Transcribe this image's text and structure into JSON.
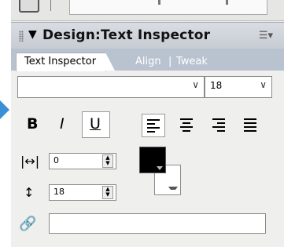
{
  "panel": {
    "title": "Design:Text Inspector",
    "collapse_glyph": "▼",
    "menu_icon": "panel-menu-icon"
  },
  "tabs": [
    {
      "label": "Text Inspector",
      "active": true
    },
    {
      "label": "Align",
      "active": false
    },
    {
      "label": "Tweak",
      "active": false
    }
  ],
  "tab_separator": "|",
  "font": {
    "family_value": "",
    "size_value": "18"
  },
  "style_buttons": {
    "bold": "B",
    "italic": "I",
    "underline": "U"
  },
  "alignment": {
    "selected": "left",
    "options": [
      "left",
      "center",
      "right",
      "justify"
    ]
  },
  "kerning": {
    "value": "0"
  },
  "leading": {
    "value": "18"
  },
  "colors": {
    "text_color": "#000000",
    "background_color": "#ffffff",
    "accent_arrow": "#3a8fd6"
  },
  "link": {
    "value": ""
  }
}
